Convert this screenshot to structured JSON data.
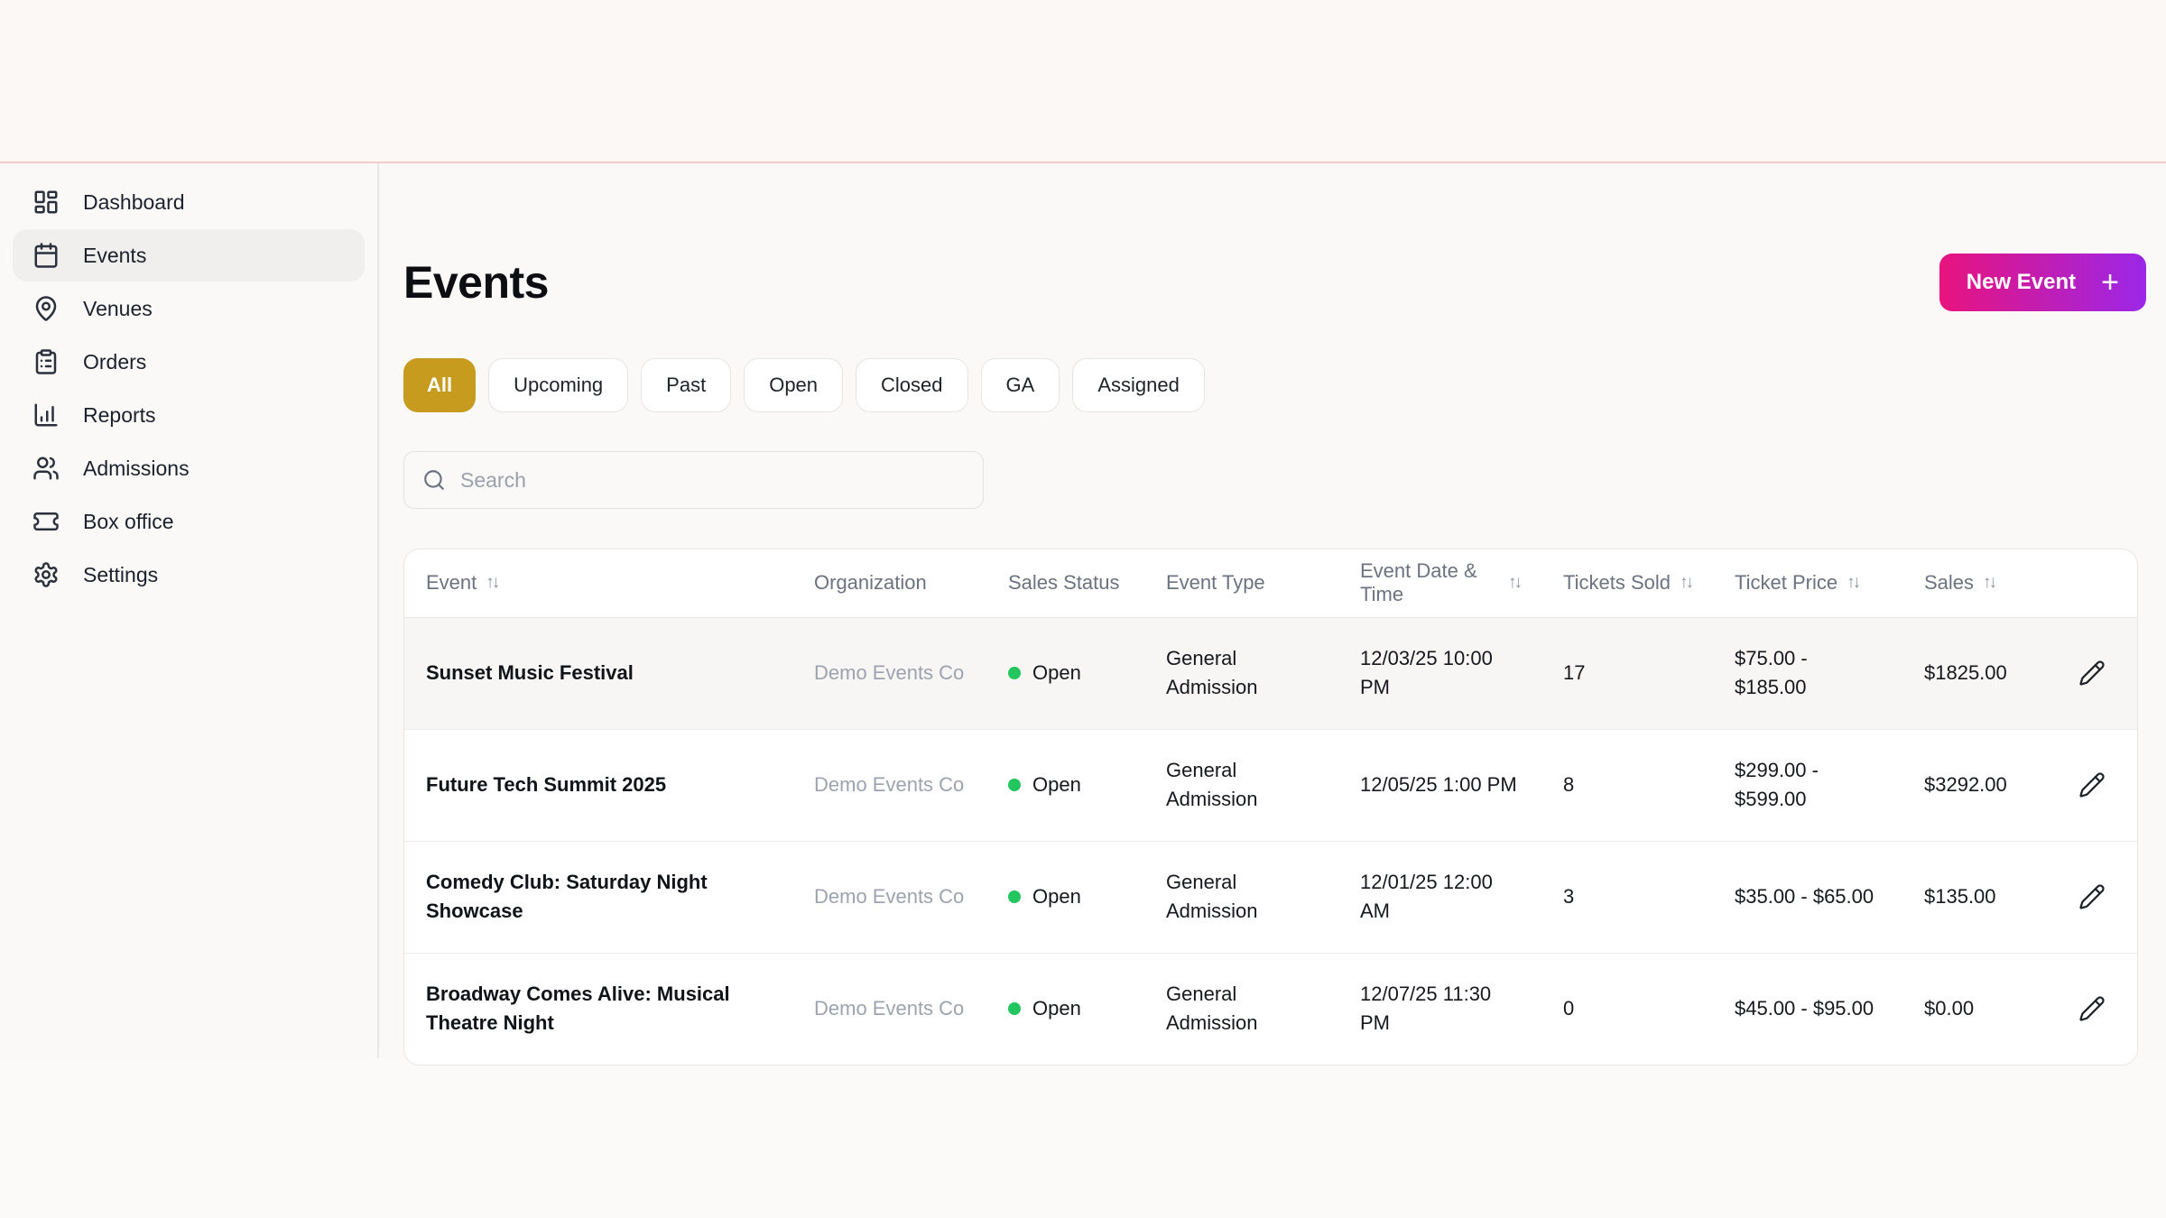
{
  "sidebar": {
    "items": [
      {
        "label": "Dashboard",
        "icon": "dashboard-icon",
        "active": false
      },
      {
        "label": "Events",
        "icon": "calendar-icon",
        "active": true
      },
      {
        "label": "Venues",
        "icon": "map-pin-icon",
        "active": false
      },
      {
        "label": "Orders",
        "icon": "clipboard-icon",
        "active": false
      },
      {
        "label": "Reports",
        "icon": "bar-chart-icon",
        "active": false
      },
      {
        "label": "Admissions",
        "icon": "users-icon",
        "active": false
      },
      {
        "label": "Box office",
        "icon": "ticket-icon",
        "active": false
      },
      {
        "label": "Settings",
        "icon": "gear-icon",
        "active": false
      }
    ]
  },
  "header": {
    "title": "Events",
    "new_event_label": "New Event",
    "new_event_plus": "+"
  },
  "filters": [
    {
      "label": "All",
      "active": true
    },
    {
      "label": "Upcoming",
      "active": false
    },
    {
      "label": "Past",
      "active": false
    },
    {
      "label": "Open",
      "active": false
    },
    {
      "label": "Closed",
      "active": false
    },
    {
      "label": "GA",
      "active": false
    },
    {
      "label": "Assigned",
      "active": false
    }
  ],
  "search": {
    "placeholder": "Search"
  },
  "table": {
    "sort_glyph": "↑↓",
    "columns": [
      {
        "label": "Event",
        "sortable": true
      },
      {
        "label": "Organization",
        "sortable": false
      },
      {
        "label": "Sales Status",
        "sortable": false
      },
      {
        "label": "Event Type",
        "sortable": false
      },
      {
        "label": "Event Date & Time",
        "sortable": true
      },
      {
        "label": "Tickets Sold",
        "sortable": true
      },
      {
        "label": "Ticket Price",
        "sortable": true
      },
      {
        "label": "Sales",
        "sortable": true
      }
    ],
    "rows": [
      {
        "event": "Sunset Music Festival",
        "organization": "Demo Events Co",
        "sales_status": "Open",
        "event_type": "General Admission",
        "date": "12/03/25 10:00 PM",
        "tickets_sold": "17",
        "ticket_price": "$75.00 - $185.00",
        "sales": "$1825.00"
      },
      {
        "event": "Future Tech Summit 2025",
        "organization": "Demo Events Co",
        "sales_status": "Open",
        "event_type": "General Admission",
        "date": "12/05/25 1:00 PM",
        "tickets_sold": "8",
        "ticket_price": "$299.00 - $599.00",
        "sales": "$3292.00"
      },
      {
        "event": "Comedy Club: Saturday Night Showcase",
        "organization": "Demo Events Co",
        "sales_status": "Open",
        "event_type": "General Admission",
        "date": "12/01/25 12:00 AM",
        "tickets_sold": "3",
        "ticket_price": "$35.00 - $65.00",
        "sales": "$135.00"
      },
      {
        "event": "Broadway Comes Alive: Musical Theatre Night",
        "organization": "Demo Events Co",
        "sales_status": "Open",
        "event_type": "General Admission",
        "date": "12/07/25 11:30 PM",
        "tickets_sold": "0",
        "ticket_price": "$45.00 - $95.00",
        "sales": "$0.00"
      }
    ]
  },
  "colors": {
    "accent_gradient_start": "#e8137d",
    "accent_gradient_end": "#9b27e8",
    "filter_active_bg": "#c79b1e",
    "status_open": "#22c55e",
    "top_divider": "#f3cdc9"
  }
}
